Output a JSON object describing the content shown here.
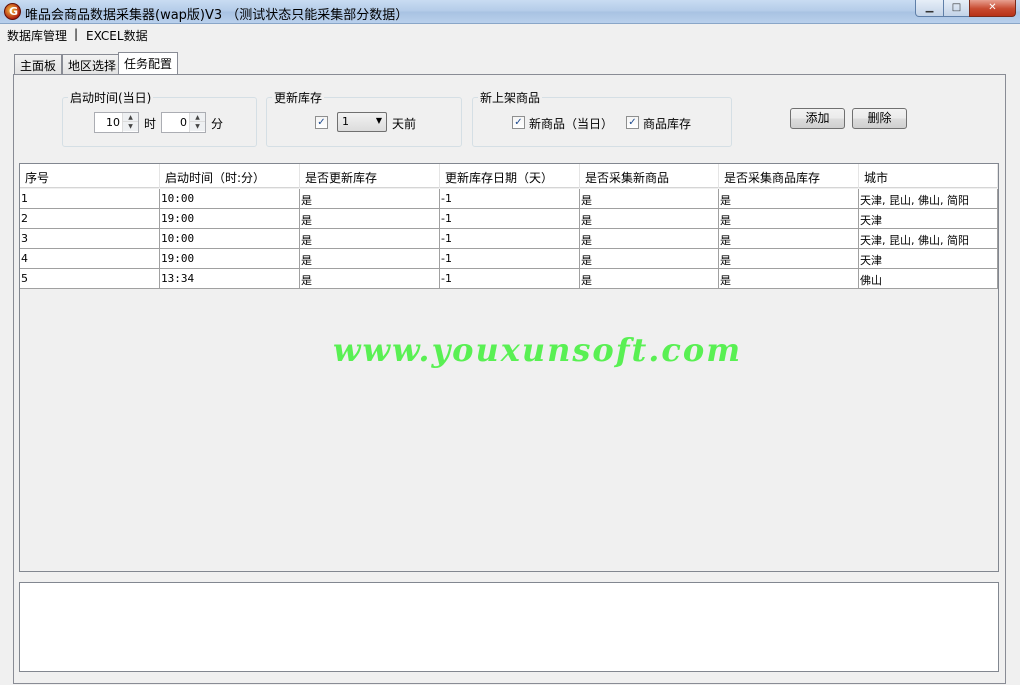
{
  "window": {
    "title": "唯品会商品数据采集器(wap版)V3 （测试状态只能采集部分数据）",
    "app_icon_glyph": "G",
    "min_glyph": "▁",
    "max_glyph": "□",
    "close_glyph": "✕"
  },
  "menu": {
    "items": [
      {
        "label": "数据库管理"
      },
      {
        "label": "|"
      },
      {
        "label": "EXCEL数据"
      }
    ]
  },
  "tabs": [
    {
      "label": "主面板",
      "active": false
    },
    {
      "label": "地区选择",
      "active": false
    },
    {
      "label": "任务配置",
      "active": true
    }
  ],
  "start_time_group": {
    "title": "启动时间(当日)",
    "hour_value": "10",
    "hour_unit": "时",
    "minute_value": "0",
    "minute_unit": "分"
  },
  "update_stock_group": {
    "title": "更新库存",
    "checked": true,
    "days_value": "1",
    "days_suffix": "天前"
  },
  "new_goods_group": {
    "title": "新上架商品",
    "new_goods_label": "新商品（当日）",
    "new_goods_checked": true,
    "stock_label": "商品库存",
    "stock_checked": true
  },
  "actions": {
    "add_label": "添加",
    "delete_label": "删除"
  },
  "table": {
    "columns": [
      "序号",
      "启动时间（时:分）",
      "是否更新库存",
      "更新库存日期（天）",
      "是否采集新商品",
      "是否采集商品库存",
      "城市"
    ],
    "rows": [
      [
        "1",
        "10:00",
        "是",
        "-1",
        "是",
        "是",
        "天津, 昆山, 佛山, 简阳"
      ],
      [
        "2",
        "19:00",
        "是",
        "-1",
        "是",
        "是",
        "天津"
      ],
      [
        "3",
        "10:00",
        "是",
        "-1",
        "是",
        "是",
        "天津, 昆山, 佛山, 简阳"
      ],
      [
        "4",
        "19:00",
        "是",
        "-1",
        "是",
        "是",
        "天津"
      ],
      [
        "5",
        "13:34",
        "是",
        "-1",
        "是",
        "是",
        "佛山"
      ]
    ]
  },
  "watermark": "www.youxunsoft.com",
  "check_glyph": "✓",
  "spin_up_glyph": "▲",
  "spin_down_glyph": "▼",
  "caret_glyph": "▼"
}
